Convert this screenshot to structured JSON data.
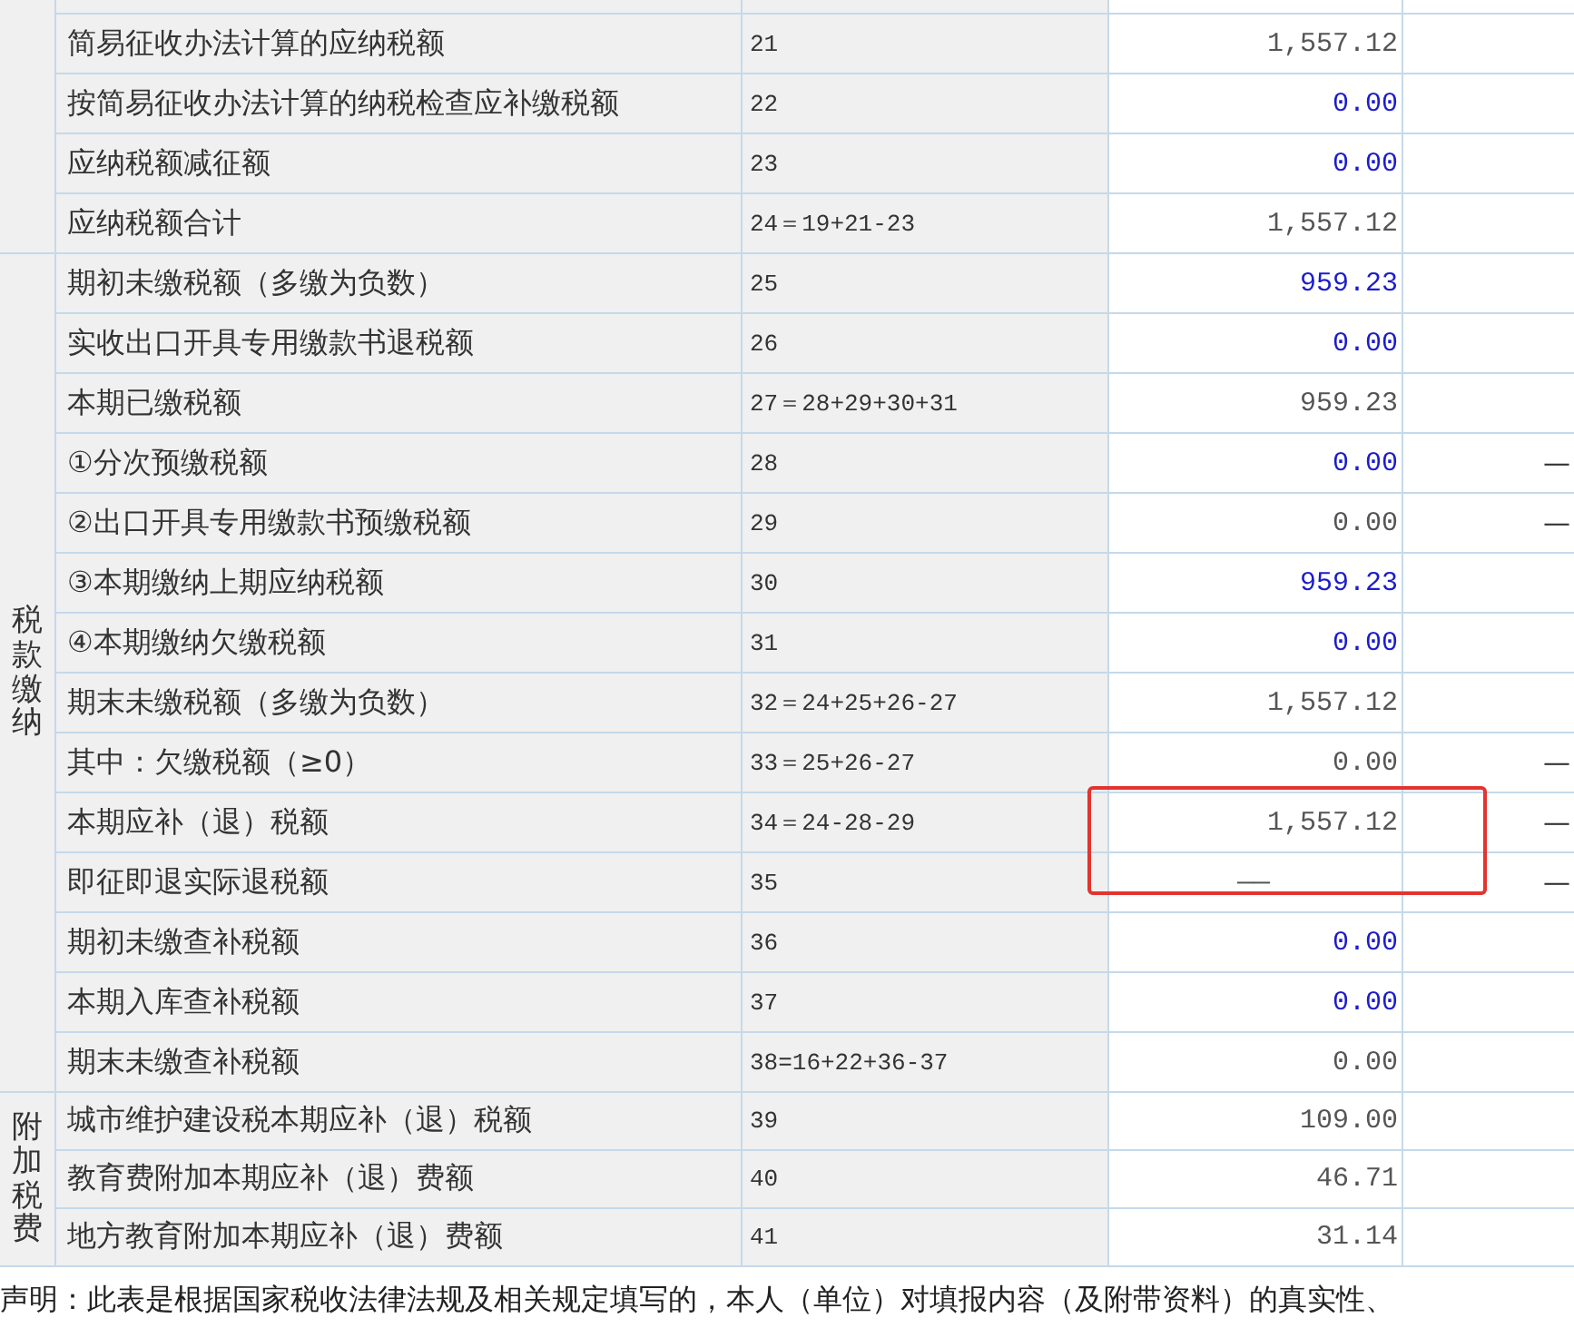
{
  "groups": [
    {
      "rows": [
        {
          "name": "简易征收办法计算的应纳税额",
          "line": "21",
          "value": "1,557.12",
          "kind": "amount",
          "editable": false,
          "highlighted": false
        },
        {
          "name": "按简易征收办法计算的纳税检查应补缴税额",
          "line": "22",
          "value": "0.00",
          "kind": "amount",
          "editable": true,
          "highlighted": false
        },
        {
          "name": "应纳税额减征额",
          "line": "23",
          "value": "0.00",
          "kind": "amount",
          "editable": true,
          "highlighted": false
        },
        {
          "name": "应纳税额合计",
          "line": "24＝19+21-23",
          "value": "1,557.12",
          "kind": "amount",
          "editable": false,
          "highlighted": false
        }
      ]
    },
    {
      "label": "税款缴纳",
      "rows": [
        {
          "name": "期初未缴税额（多缴为负数）",
          "line": "25",
          "value": "959.23",
          "kind": "amount",
          "editable": true,
          "highlighted": false
        },
        {
          "name": "实收出口开具专用缴款书退税额",
          "line": "26",
          "value": "0.00",
          "kind": "amount",
          "editable": true,
          "highlighted": false
        },
        {
          "name": "本期已缴税额",
          "line": "27＝28+29+30+31",
          "value": "959.23",
          "kind": "amount",
          "editable": false,
          "highlighted": false
        },
        {
          "name": "①分次预缴税额",
          "line": "28",
          "value": "0.00",
          "kind": "amount",
          "editable": true,
          "highlighted": false,
          "column_5": "—"
        },
        {
          "name": "②出口开具专用缴款书预缴税额",
          "line": "29",
          "value": "0.00",
          "kind": "amount",
          "editable": false,
          "highlighted": false,
          "column_5": "—"
        },
        {
          "name": "③本期缴纳上期应纳税额",
          "line": "30",
          "value": "959.23",
          "kind": "amount",
          "editable": true,
          "highlighted": false
        },
        {
          "name": "④本期缴纳欠缴税额",
          "line": "31",
          "value": "0.00",
          "kind": "amount",
          "editable": true,
          "highlighted": false
        },
        {
          "name": "期末未缴税额（多缴为负数）",
          "line": "32＝24+25+26-27",
          "value": "1,557.12",
          "kind": "amount",
          "editable": false,
          "highlighted": false
        },
        {
          "name": "其中：欠缴税额（≥0）",
          "line": "33＝25+26-27",
          "value": "0.00",
          "kind": "amount",
          "editable": false,
          "highlighted": false,
          "column_5": "—"
        },
        {
          "name": "本期应补（退）税额",
          "line": "34＝24-28-29",
          "value": "1,557.12",
          "kind": "amount",
          "editable": false,
          "highlighted": true,
          "column_5": "—"
        },
        {
          "name": "即征即退实际退税额",
          "line": "35",
          "value": "——",
          "kind": "not-applicable",
          "editable": false,
          "highlighted": true,
          "column_5": "—"
        },
        {
          "name": "期初未缴查补税额",
          "line": "36",
          "value": "0.00",
          "kind": "amount",
          "editable": true,
          "highlighted": false
        },
        {
          "name": "本期入库查补税额",
          "line": "37",
          "value": "0.00",
          "kind": "amount",
          "editable": true,
          "highlighted": false
        },
        {
          "name": "期末未缴查补税额",
          "line": "38=16+22+36-37",
          "value": "0.00",
          "kind": "amount",
          "editable": false,
          "highlighted": false
        }
      ]
    },
    {
      "label": "附加税费",
      "rows": [
        {
          "name": "城市维护建设税本期应补（退）税额",
          "line": "39",
          "value": "109.00",
          "kind": "amount",
          "editable": false,
          "highlighted": false
        },
        {
          "name": "教育费附加本期应补（退）费额",
          "line": "40",
          "value": "46.71",
          "kind": "amount",
          "editable": false,
          "highlighted": false
        },
        {
          "name": "地方教育附加本期应补（退）费额",
          "line": "41",
          "value": "31.14",
          "kind": "amount",
          "editable": false,
          "highlighted": false
        }
      ]
    }
  ],
  "declaration": "声明：此表是根据国家税收法律法规及相关规定填写的，本人（单位）对填报内容（及附带资料）的真实性、"
}
